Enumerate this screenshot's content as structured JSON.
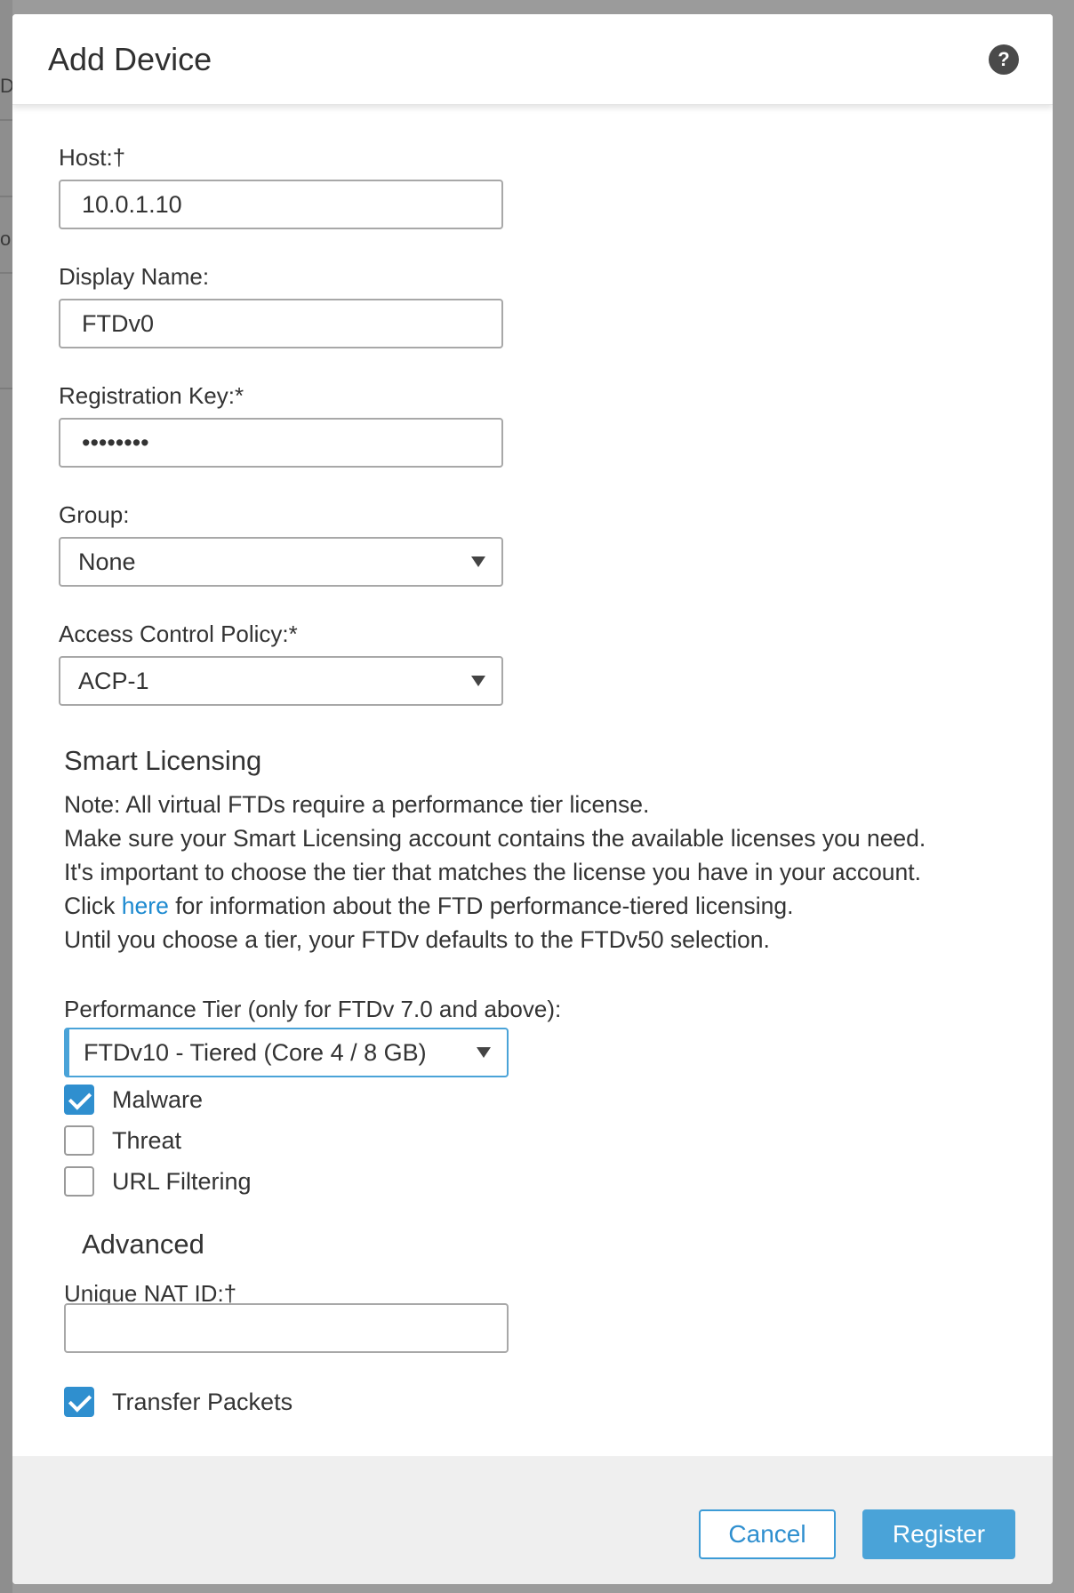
{
  "background": {
    "chars": [
      "D",
      "o"
    ]
  },
  "modal": {
    "title": "Add Device",
    "help_icon": "?"
  },
  "form": {
    "host": {
      "label": "Host:†",
      "value": "10.0.1.10"
    },
    "display_name": {
      "label": "Display Name:",
      "value": "FTDv0"
    },
    "registration_key": {
      "label": "Registration Key:*",
      "value": "••••••••"
    },
    "group": {
      "label": "Group:",
      "value": "None"
    },
    "access_control_policy": {
      "label": "Access Control Policy:*",
      "value": "ACP-1"
    }
  },
  "smart_licensing": {
    "heading": "Smart Licensing",
    "note_lines": [
      "Note: All virtual FTDs require a performance tier license.",
      "Make sure your Smart Licensing account contains the available licenses you need.",
      "It's important to choose the tier that matches the license you have in your account."
    ],
    "click_prefix": "Click",
    "link_text": "here",
    "click_suffix": "for information about the FTD performance-tiered licensing.",
    "default_line": "Until you choose a tier, your FTDv defaults to the FTDv50 selection.",
    "performance_tier": {
      "label": "Performance Tier (only for FTDv 7.0 and above):",
      "value": "FTDv10 - Tiered (Core 4 / 8 GB)"
    },
    "licenses": [
      {
        "label": "Malware",
        "checked": true
      },
      {
        "label": "Threat",
        "checked": false
      },
      {
        "label": "URL Filtering",
        "checked": false
      }
    ]
  },
  "advanced": {
    "heading": "Advanced",
    "unique_nat_id": {
      "label": "Unique NAT ID:†",
      "value": ""
    },
    "transfer_packets": {
      "label": "Transfer Packets",
      "checked": true
    }
  },
  "footer": {
    "cancel_label": "Cancel",
    "register_label": "Register"
  },
  "colors": {
    "accent": "#4aa3d8",
    "link": "#1d8ad0",
    "checkbox_checked": "#2f8fcf"
  }
}
